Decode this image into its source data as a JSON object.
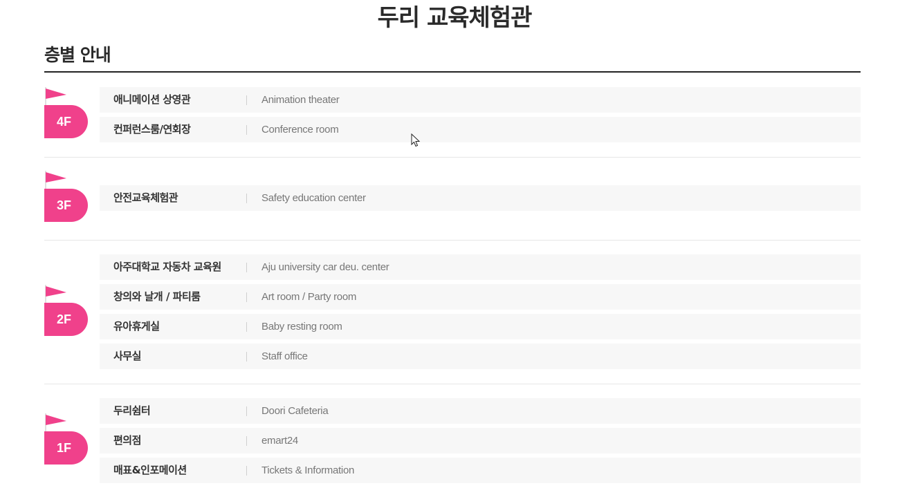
{
  "page": {
    "title": "두리 교육체험관"
  },
  "section": {
    "title": "층별 안내"
  },
  "floors": [
    {
      "label": "4F",
      "rooms": [
        {
          "name_ko": "애니메이션 상영관",
          "name_en": "Animation theater"
        },
        {
          "name_ko": "컨퍼런스룸/연회장",
          "name_en": "Conference room"
        }
      ]
    },
    {
      "label": "3F",
      "rooms": [
        {
          "name_ko": "안전교육체험관",
          "name_en": "Safety education center"
        }
      ]
    },
    {
      "label": "2F",
      "rooms": [
        {
          "name_ko": "아주대학교 자동차 교육원",
          "name_en": "Aju university car deu. center"
        },
        {
          "name_ko": "창의와 날개 / 파티룸",
          "name_en": "Art room / Party room"
        },
        {
          "name_ko": "유아휴게실",
          "name_en": "Baby resting room"
        },
        {
          "name_ko": "사무실",
          "name_en": "Staff office"
        }
      ]
    },
    {
      "label": "1F",
      "rooms": [
        {
          "name_ko": "두리쉼터",
          "name_en": "Doori Cafeteria"
        },
        {
          "name_ko": "편의점",
          "name_en": "emart24"
        },
        {
          "name_ko": "매표&인포메이션",
          "name_en": "Tickets & Information"
        }
      ]
    }
  ],
  "colors": {
    "accent": "#f0418b",
    "row_bg": "#f7f7f7",
    "rule": "#222222"
  },
  "icons": {
    "floor_marker": "flag-icon",
    "pointer": "mouse-cursor-icon"
  }
}
